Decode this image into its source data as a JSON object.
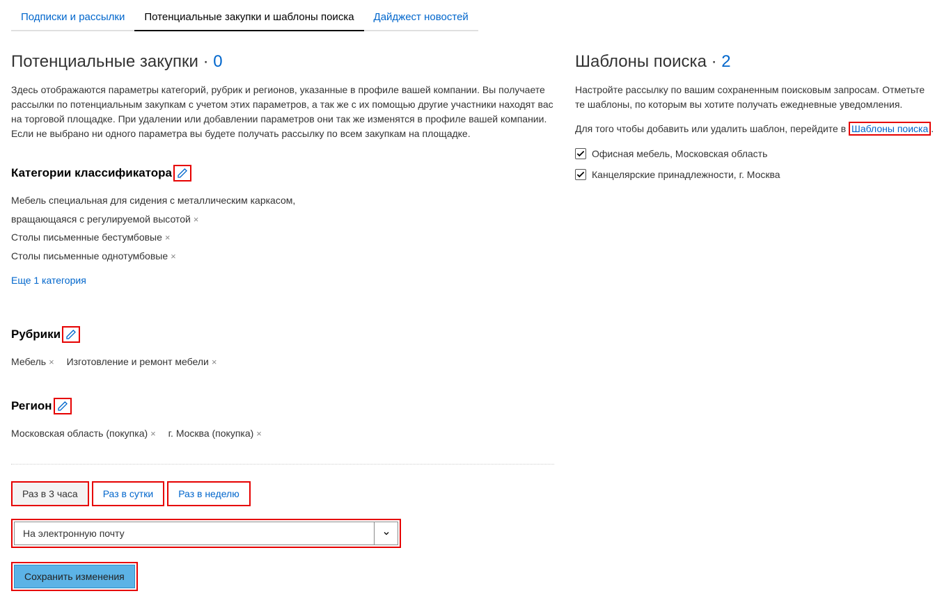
{
  "tabs": {
    "subscriptions": "Подписки и рассылки",
    "potential": "Потенциальные закупки и шаблоны поиска",
    "digest": "Дайджест новостей"
  },
  "left": {
    "title": "Потенциальные закупки",
    "count": "0",
    "desc": "Здесь отображаются параметры категорий, рубрик и регионов, указанные в профиле вашей компании. Вы получаете рассылки по потенциальным закупкам с учетом этих параметров, а так же с их помощью другие участники находят вас на торговой площадке. При удалении или добавлении параметров они так же изменятся в профиле вашей компании. Если не выбрано ни одного параметра вы будете получать рассылку по всем закупкам на площадке.",
    "categories": {
      "title": "Категории классификатора",
      "items": [
        "Мебель специальная для сидения с металлическим каркасом, вращающаяся с регулируемой высотой",
        "Столы письменные бестумбовые",
        "Столы письменные однотумбовые"
      ],
      "more": "Еще 1 категория"
    },
    "rubrics": {
      "title": "Рубрики",
      "items": [
        "Мебель",
        "Изготовление и ремонт мебели"
      ]
    },
    "region": {
      "title": "Регион",
      "items": [
        "Московская область (покупка)",
        "г. Москва (покупка)"
      ]
    },
    "frequency": {
      "opt1": "Раз в 3 часа",
      "opt2": "Раз в сутки",
      "opt3": "Раз в неделю"
    },
    "delivery": "На электронную почту",
    "save": "Сохранить изменения"
  },
  "right": {
    "title": "Шаблоны поиска",
    "count": "2",
    "desc": "Настройте рассылку по вашим сохраненным поисковым запросам. Отметьте те шаблоны, по которым вы хотите получать ежедневные уведомления.",
    "note_prefix": "Для того чтобы добавить или удалить шаблон, перейдите в ",
    "note_link": "Шаблоны поиска",
    "note_suffix": ".",
    "templates": [
      "Офисная мебель, Московская область",
      "Канцелярские принадлежности, г. Москва"
    ]
  }
}
